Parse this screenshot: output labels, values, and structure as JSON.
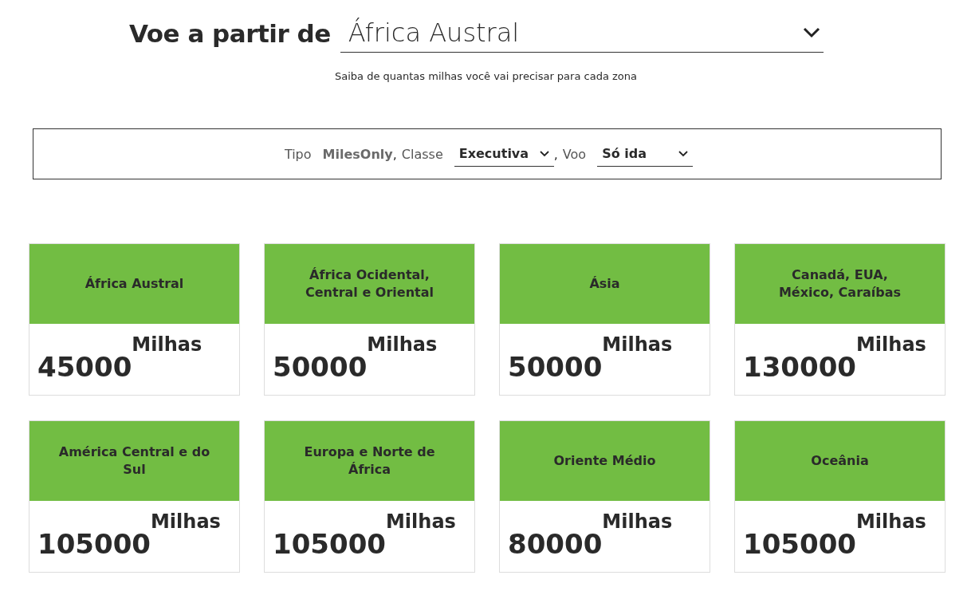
{
  "heading": {
    "label": "Voe a partir de",
    "value": "África Austral"
  },
  "subtitle": "Saiba de quantas milhas você vai precisar para cada zona",
  "filters": [
    {
      "kind": "text",
      "label": "Tipo",
      "value": "MilesOnly",
      "separator": ","
    },
    {
      "kind": "select",
      "label": "Classe",
      "value": "Executiva",
      "separator": ","
    },
    {
      "kind": "select",
      "label": "Voo",
      "value": "Só ida"
    }
  ],
  "zones": [
    {
      "name": "África Austral",
      "miles": "45000",
      "unit": "Milhas"
    },
    {
      "name": "África Ocidental, Central e Oriental",
      "miles": "50000",
      "unit": "Milhas"
    },
    {
      "name": "Ásia",
      "miles": "50000",
      "unit": "Milhas"
    },
    {
      "name": "Canadá, EUA, México, Caraíbas",
      "miles": "130000",
      "unit": "Milhas"
    },
    {
      "name": "América Central e do Sul",
      "miles": "105000",
      "unit": "Milhas"
    },
    {
      "name": "Europa e Norte de África",
      "miles": "105000",
      "unit": "Milhas"
    },
    {
      "name": "Oriente Médio",
      "miles": "80000",
      "unit": "Milhas"
    },
    {
      "name": "Oceânia",
      "miles": "105000",
      "unit": "Milhas"
    }
  ]
}
